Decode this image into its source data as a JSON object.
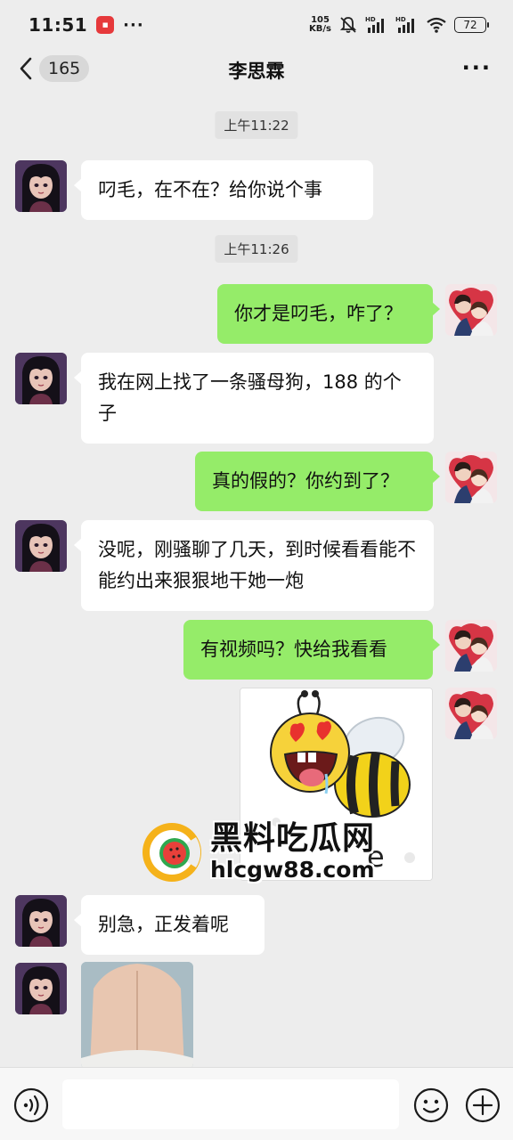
{
  "status_bar": {
    "time": "11:51",
    "dots": "···",
    "net_speed_value": "105",
    "net_speed_unit": "KB/s",
    "battery": "72"
  },
  "header": {
    "back_count": "165",
    "title": "李思霖",
    "more": "···"
  },
  "messages": [
    {
      "type": "time",
      "text": "上午11:22"
    },
    {
      "type": "text",
      "from": "them",
      "text": "叼毛，在不在？给你说个事"
    },
    {
      "type": "time",
      "text": "上午11:26"
    },
    {
      "type": "text",
      "from": "me",
      "text": "你才是叼毛，咋了？"
    },
    {
      "type": "text",
      "from": "them",
      "text": "我在网上找了一条骚母狗，188 的个子"
    },
    {
      "type": "text",
      "from": "me",
      "text": "真的假的？你约到了？"
    },
    {
      "type": "text",
      "from": "them",
      "text": "没呢，刚骚聊了几天，到时候看看能不能约出来狠狠地干她一炮"
    },
    {
      "type": "text",
      "from": "me",
      "text": "有视频吗？快给我看看"
    },
    {
      "type": "sticker",
      "from": "me",
      "text": "e"
    },
    {
      "type": "text",
      "from": "them",
      "text": "别急，正发着呢"
    },
    {
      "type": "image",
      "from": "them"
    }
  ],
  "watermark": {
    "title": "黑料吃瓜网",
    "url": "hlcgw88.com"
  },
  "colors": {
    "background": "#ededed",
    "bubble_me": "#95ec69",
    "bubble_them": "#ffffff"
  },
  "input_bar": {
    "value": ""
  }
}
